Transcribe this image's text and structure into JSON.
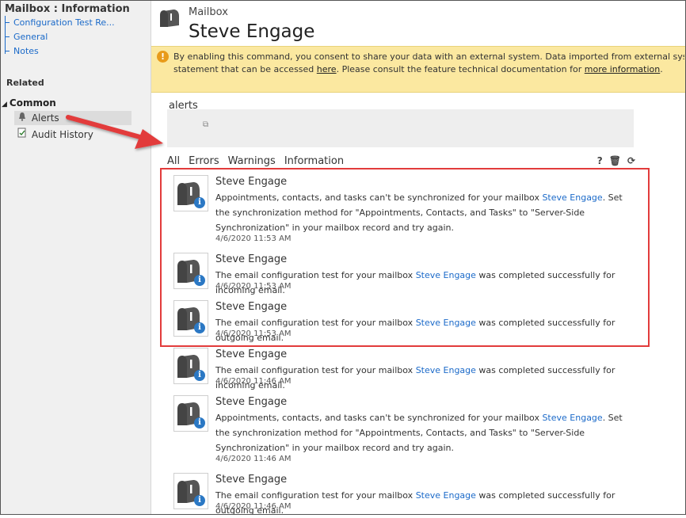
{
  "sidebar": {
    "title": "Mailbox : Information",
    "links": [
      "Configuration Test Re...",
      "General",
      "Notes"
    ],
    "related": "Related",
    "common": "Common",
    "items": [
      {
        "label": "Alerts",
        "icon": "bell-icon"
      },
      {
        "label": "Audit History",
        "icon": "audit-history-icon"
      }
    ]
  },
  "header": {
    "entity": "Mailbox",
    "name": "Steve Engage",
    "icon": "mailbox-icon"
  },
  "notice": {
    "line1": "By enabling this command, you consent to share your data with an external system. Data imported from external systems into Microsoft",
    "line2_a": "statement that can be accessed ",
    "link1": "here",
    "line2_b": ". Please consult the feature technical documentation for ",
    "link2": "more information",
    "line2_c": ".",
    "icon": "warning-icon"
  },
  "alerts_label": "alerts",
  "filters": [
    "All",
    "Errors",
    "Warnings",
    "Information"
  ],
  "tools": {
    "help": "?",
    "delete": "🗑",
    "refresh": "⟳"
  },
  "list": [
    {
      "title": "Steve Engage",
      "pre": "Appointments, contacts, and tasks can't be synchronized for your mailbox ",
      "link": "Steve Engage",
      "post": ". Set the synchronization method for \"Appointments, Contacts, and Tasks\" to \"Server-Side Synchronization\" in your mailbox record and try again.",
      "date": "4/6/2020 11:53 AM"
    },
    {
      "title": "Steve Engage",
      "pre": "The email configuration test for your mailbox ",
      "link": "Steve Engage",
      "post": " was completed successfully for incoming email.",
      "date": "4/6/2020 11:53 AM"
    },
    {
      "title": "Steve Engage",
      "pre": "The email configuration test for your mailbox ",
      "link": "Steve Engage",
      "post": " was completed successfully for outgoing email.",
      "date": "4/6/2020 11:53 AM"
    },
    {
      "title": "Steve Engage",
      "pre": "The email configuration test for your mailbox ",
      "link": "Steve Engage",
      "post": " was completed successfully for incoming email.",
      "date": "4/6/2020 11:46 AM"
    },
    {
      "title": "Steve Engage",
      "pre": "Appointments, contacts, and tasks can't be synchronized for your mailbox ",
      "link": "Steve Engage",
      "post": ". Set the synchronization method for \"Appointments, Contacts, and Tasks\" to \"Server-Side Synchronization\" in your mailbox record and try again.",
      "date": "4/6/2020 11:46 AM"
    },
    {
      "title": "Steve Engage",
      "pre": "The email configuration test for your mailbox ",
      "link": "Steve Engage",
      "post": " was completed successfully for outgoing email.",
      "date": "4/6/2020 11:46 AM"
    }
  ],
  "colors": {
    "link": "#1b6ac9",
    "notice_bg": "#fbe8a0",
    "highlight": "#e23b3b",
    "info_badge": "#2b78c4"
  }
}
